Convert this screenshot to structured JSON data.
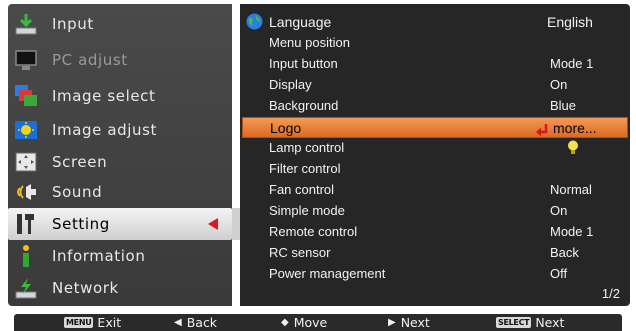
{
  "main_menu": {
    "items": [
      {
        "label": "Input",
        "icon": "input-icon",
        "state": "normal"
      },
      {
        "label": "PC adjust",
        "icon": "pc-adjust-icon",
        "state": "disabled"
      },
      {
        "label": "Image select",
        "icon": "image-select-icon",
        "state": "normal"
      },
      {
        "label": "Image adjust",
        "icon": "image-adjust-icon",
        "state": "normal"
      },
      {
        "label": "Screen",
        "icon": "screen-icon",
        "state": "normal"
      },
      {
        "label": "Sound",
        "icon": "sound-icon",
        "state": "normal"
      },
      {
        "label": "Setting",
        "icon": "setting-icon",
        "state": "selected"
      },
      {
        "label": "Information",
        "icon": "information-icon",
        "state": "normal"
      },
      {
        "label": "Network",
        "icon": "network-icon",
        "state": "normal"
      }
    ]
  },
  "setting_menu": {
    "rows": [
      {
        "name": "Language",
        "value": "English"
      },
      {
        "name": "Menu position",
        "value": ""
      },
      {
        "name": "Input button",
        "value": "Mode 1"
      },
      {
        "name": "Display",
        "value": "On"
      },
      {
        "name": "Background",
        "value": "Blue"
      },
      {
        "name": "Logo",
        "value": "more..."
      },
      {
        "name": "Lamp control",
        "value": ""
      },
      {
        "name": "Filter control",
        "value": ""
      },
      {
        "name": "Fan control",
        "value": "Normal"
      },
      {
        "name": "Simple mode",
        "value": "On"
      },
      {
        "name": "Remote control",
        "value": "Mode 1"
      },
      {
        "name": "RC sensor",
        "value": "Back"
      },
      {
        "name": "Power management",
        "value": "Off"
      }
    ],
    "highlighted_row": "Logo",
    "page": "1/2"
  },
  "footer": {
    "exit_key": "MENU",
    "exit_label": "Exit",
    "back_symbol": "◀",
    "back_label": "Back",
    "move_symbol": "◆",
    "move_label": "Move",
    "next_symbol": "▶",
    "next_label": "Next",
    "select_key": "SELECT",
    "select_next_label": "Next"
  },
  "colors": {
    "highlight": "#ee8844",
    "selected_arrow": "#e0141c",
    "panel_bg": "#262626"
  }
}
